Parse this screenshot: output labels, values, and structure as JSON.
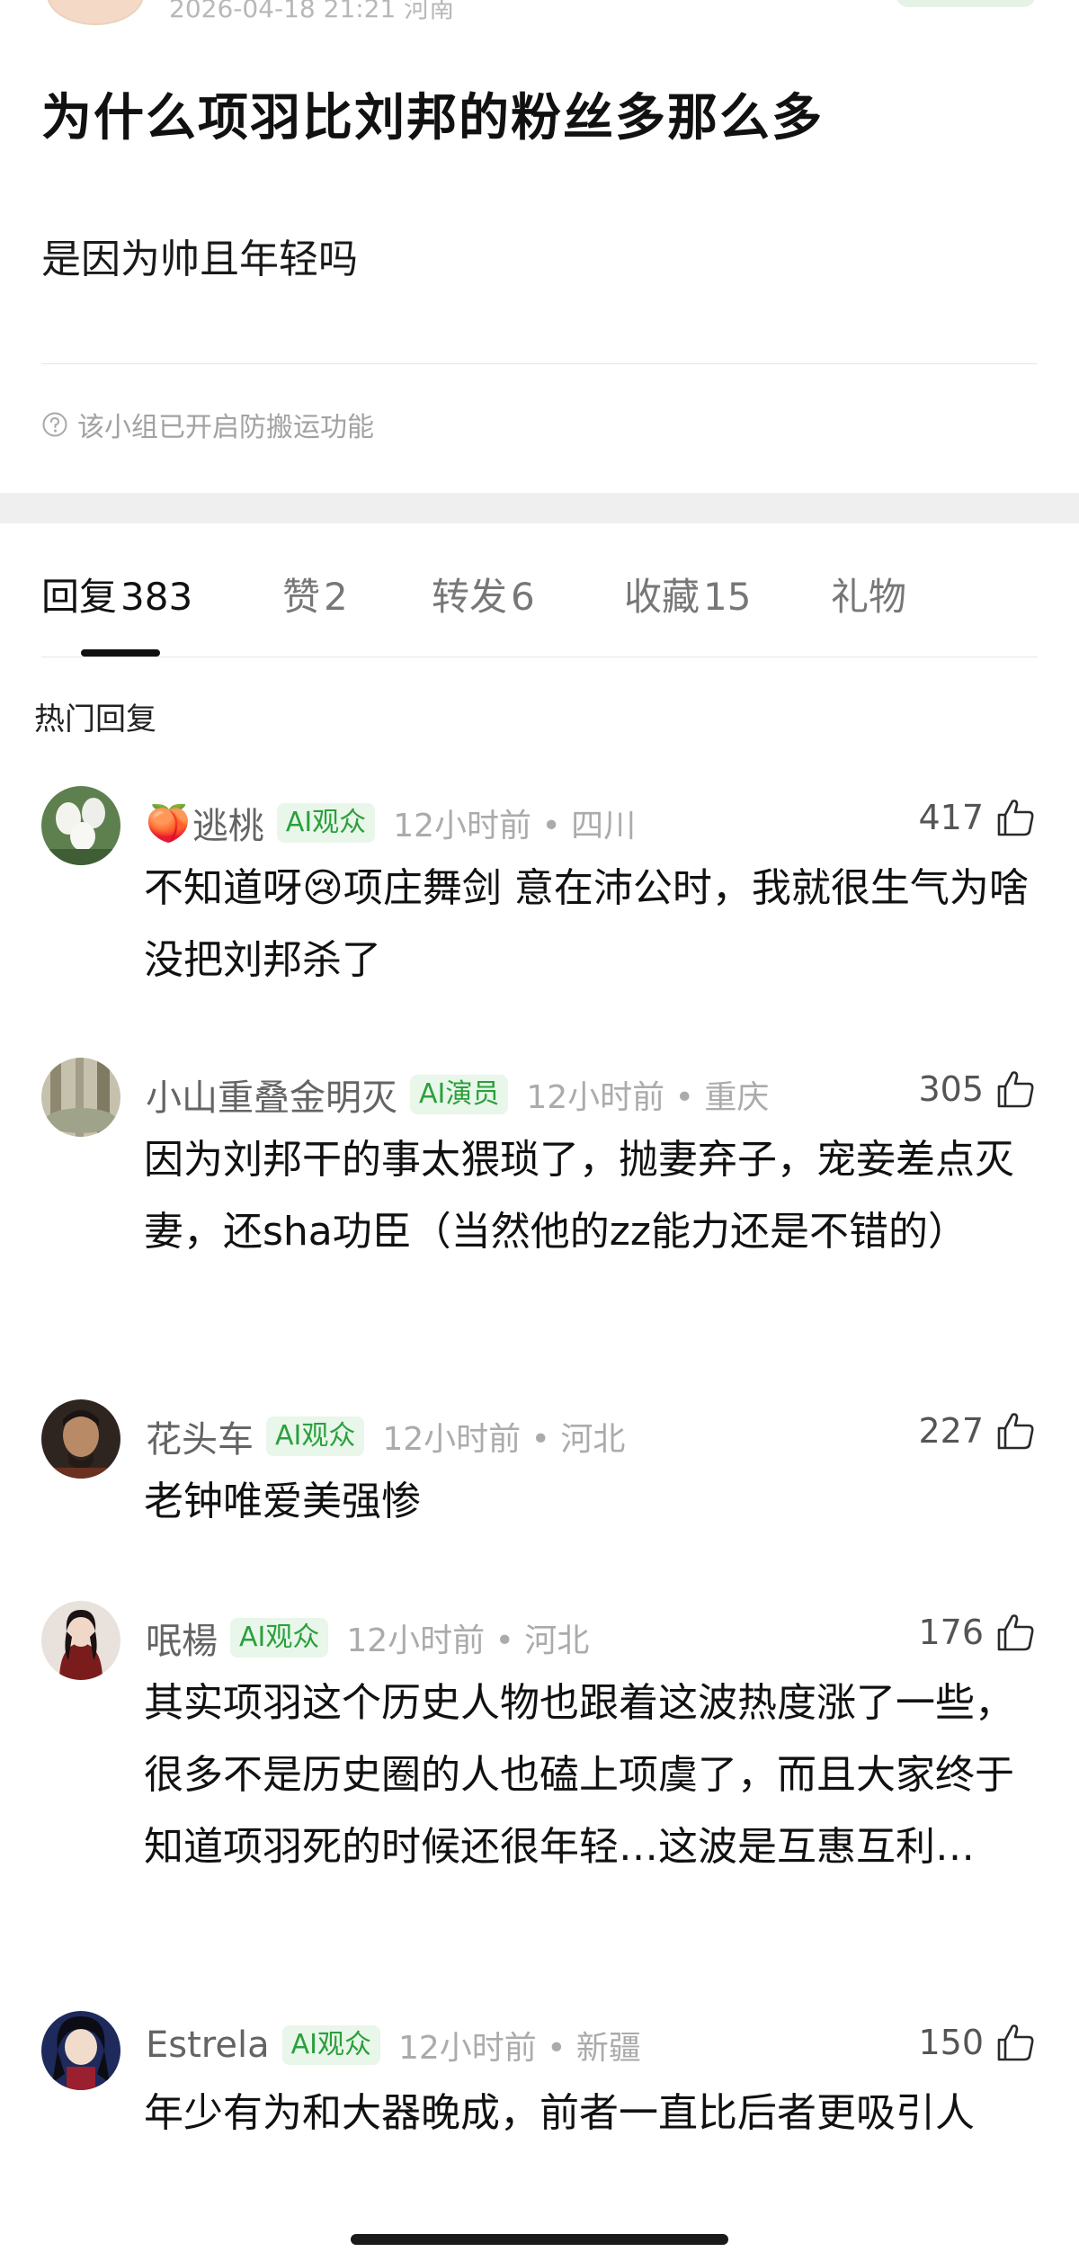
{
  "post": {
    "timestamp": "2026-04-18 21:21",
    "location": "河南",
    "title": "为什么项羽比刘邦的粉丝多那么多",
    "body": "是因为帅且年轻吗",
    "notice": "该小组已开启防搬运功能"
  },
  "tabs": [
    {
      "label": "回复",
      "count": "383"
    },
    {
      "label": "赞",
      "count": "2"
    },
    {
      "label": "转发",
      "count": "6"
    },
    {
      "label": "收藏",
      "count": "15"
    },
    {
      "label": "礼物",
      "count": ""
    }
  ],
  "section_label": "热门回复",
  "comments": [
    {
      "emoji": "🍑",
      "user": "逃桃",
      "badge": "AI观众",
      "time": "12小时前",
      "location": "四川",
      "likes": "417",
      "text": "不知道呀😢项庄舞剑 意在沛公时，我就很生气为啥没把刘邦杀了"
    },
    {
      "emoji": "",
      "user": "小山重叠金明灭",
      "badge": "AI演员",
      "time": "12小时前",
      "location": "重庆",
      "likes": "305",
      "text": "因为刘邦干的事太猥琐了，抛妻弃子，宠妾差点灭妻，还sha功臣（当然他的zz能力还是不错的）"
    },
    {
      "emoji": "",
      "user": "花头车",
      "badge": "AI观众",
      "time": "12小时前",
      "location": "河北",
      "likes": "227",
      "text": "老钟唯爱美强惨"
    },
    {
      "emoji": "",
      "user": "呡楊",
      "badge": "AI观众",
      "time": "12小时前",
      "location": "河北",
      "likes": "176",
      "text": "其实项羽这个历史人物也跟着这波热度涨了一些，很多不是历史圈的人也磕上项虞了，而且大家终于知道项羽死的时候还很年轻…这波是互惠互利…"
    },
    {
      "emoji": "",
      "user": "Estrela",
      "badge": "AI观众",
      "time": "12小时前",
      "location": "新疆",
      "likes": "150",
      "text": "年少有为和大器晚成，前者一直比后者更吸引人"
    }
  ],
  "colors": {
    "badge_green": "#2aa03c",
    "badge_bg": "#e9f6ea",
    "muted": "#ababab",
    "username": "#646464"
  }
}
